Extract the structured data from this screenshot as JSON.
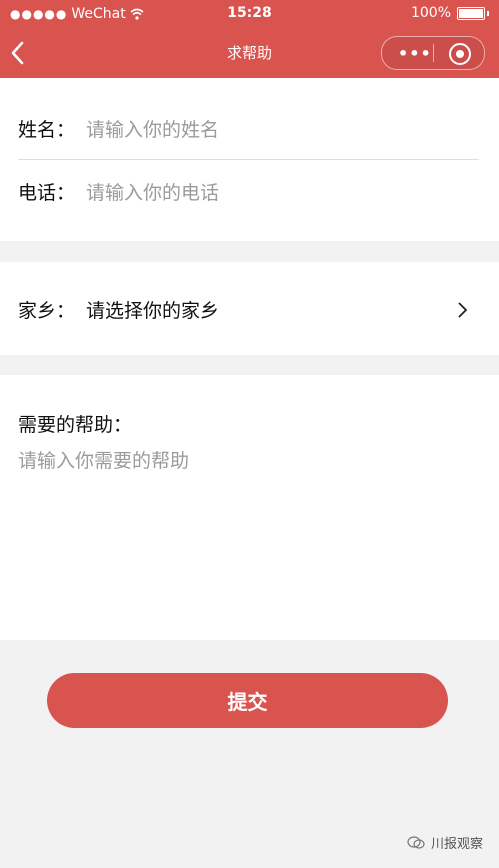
{
  "status_bar": {
    "carrier": "WeChat",
    "time": "15:28",
    "battery": "100%"
  },
  "nav": {
    "title": "求帮助"
  },
  "form": {
    "name_label": "姓名：",
    "name_placeholder": "请输入你的姓名",
    "phone_label": "电话：",
    "phone_placeholder": "请输入你的电话",
    "hometown_label": "家乡：",
    "hometown_value": "请选择你的家乡",
    "help_label": "需要的帮助：",
    "help_placeholder": "请输入你需要的帮助"
  },
  "submit_label": "提交",
  "watermark": "川报观察",
  "colors": {
    "accent": "#d9534f",
    "background": "#f2f2f2",
    "placeholder": "#9b9b9b"
  }
}
